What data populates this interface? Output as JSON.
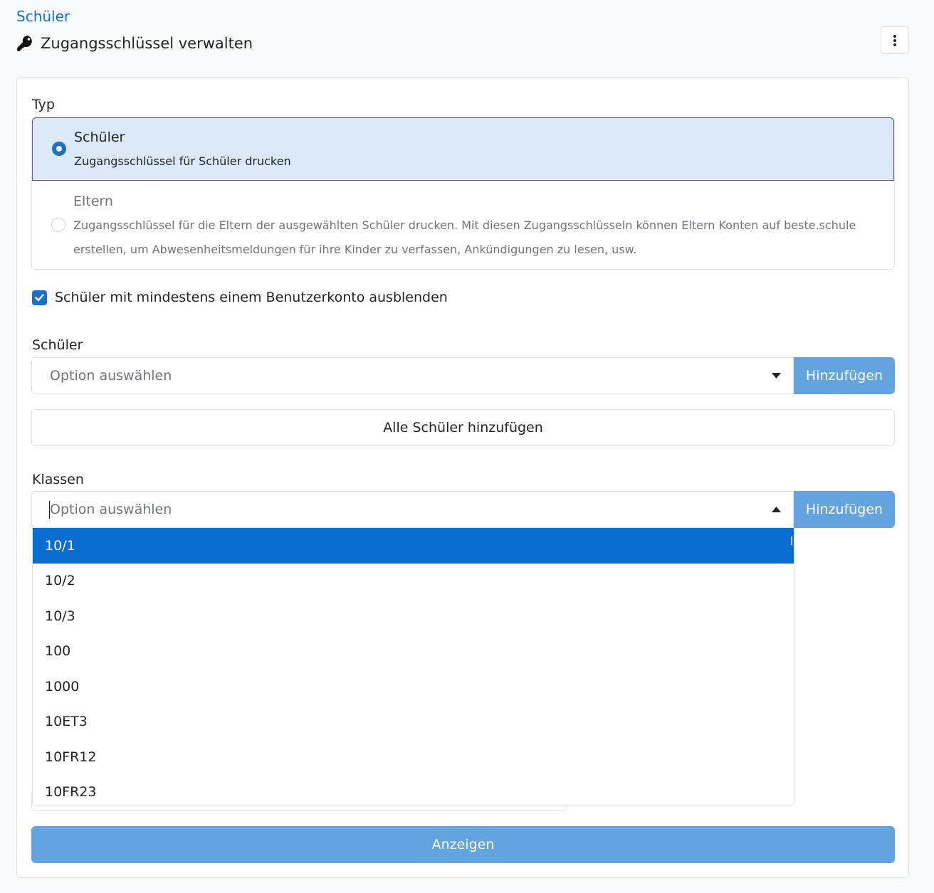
{
  "breadcrumb": "Schüler",
  "page_title": "Zugangsschlüssel verwalten",
  "icons": {
    "title": "key-icon",
    "menu": "more-vertical-icon"
  },
  "colors": {
    "primary": "#1a6fc7",
    "button_disabled": "#63a3e0",
    "highlight": "#0a6dd1"
  },
  "type_section": {
    "label": "Typ",
    "options": [
      {
        "title": "Schüler",
        "description": "Zugangsschlüssel für Schüler drucken",
        "selected": true
      },
      {
        "title": "Eltern",
        "description": "Zugangsschlüssel für die Eltern der ausgewählten Schüler drucken. Mit diesen Zugangsschlüsseln können Eltern Konten auf beste.schule erstellen, um Abwesenheitsmeldungen für ihre Kinder zu verfassen, Ankündigungen zu lesen, usw.",
        "selected": false
      }
    ]
  },
  "hide_checkbox": {
    "label": "Schüler mit mindestens einem Benutzerkonto ausblenden",
    "checked": true
  },
  "students": {
    "label": "Schüler",
    "placeholder": "Option auswählen",
    "add_label": "Hinzufügen",
    "add_all_label": "Alle Schüler hinzufügen"
  },
  "classes": {
    "label": "Klassen",
    "placeholder": "Option auswählen",
    "add_label": "Hinzufügen",
    "dropdown_open": true,
    "options": [
      "10/1",
      "10/2",
      "10/3",
      "100",
      "1000",
      "10ET3",
      "10FR12",
      "10FR23"
    ],
    "highlighted": "10/1"
  },
  "submit_label": "Anzeigen"
}
